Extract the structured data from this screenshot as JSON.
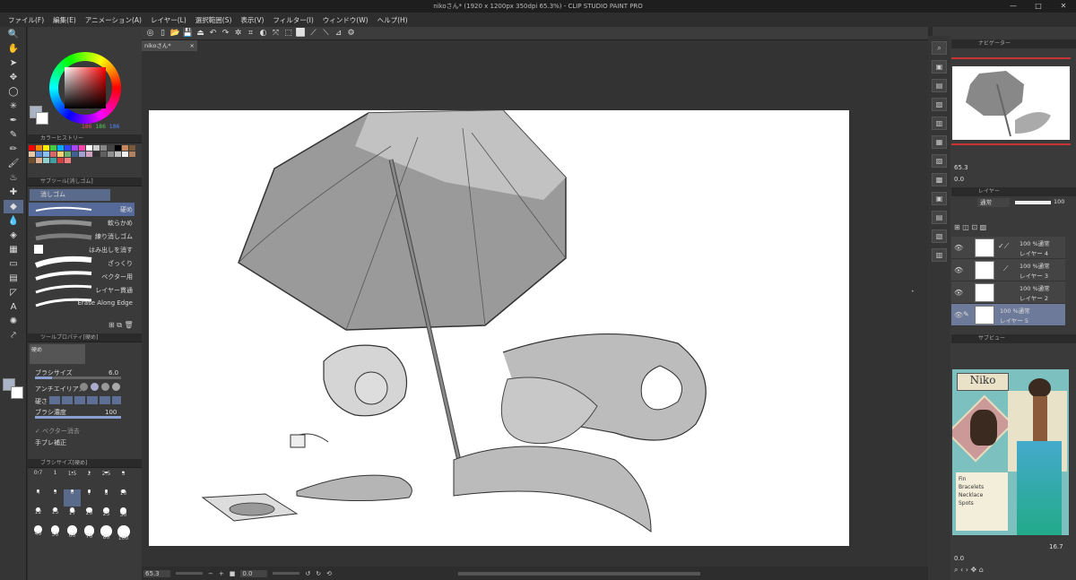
{
  "window": {
    "title": "nikoさん* (1920 x 1200px 350dpi 65.3%) - CLIP STUDIO PAINT PRO",
    "controls": [
      "—",
      "□",
      "✕"
    ]
  },
  "menu": [
    "ファイル(F)",
    "編集(E)",
    "アニメーション(A)",
    "レイヤー(L)",
    "選択範囲(S)",
    "表示(V)",
    "フィルター(I)",
    "ウィンドウ(W)",
    "ヘルプ(H)"
  ],
  "tab": {
    "label": "nikoさん*",
    "close": "×"
  },
  "color": {
    "h": "186",
    "s": "186",
    "v": "186",
    "main": "#a9b4c6",
    "sub": "#ffffff"
  },
  "history_title": "カラーヒストリー",
  "history_colors": [
    "#ff0000",
    "#ff8800",
    "#ffee00",
    "#44cc44",
    "#00aaff",
    "#3344ff",
    "#aa44ff",
    "#ff44aa",
    "#ffffff",
    "#cccccc",
    "#888888",
    "#444444",
    "#000000",
    "#c9885c",
    "#7a5a3a",
    "#e8c8a8",
    "#5a8ad8",
    "#88c0f0",
    "#d86868",
    "#f0d070",
    "#70b070",
    "#406090",
    "#a0a0d0",
    "#d0a0c0",
    "#303030",
    "#606060",
    "#909090",
    "#c0c0c0",
    "#f0f0f0",
    "#b08060",
    "#705030",
    "#e0b090",
    "#90d0d0",
    "#40a0a0",
    "#d04040",
    "#f08080"
  ],
  "subtool": {
    "title": "サブツール[消しゴム]",
    "group": "消しゴム",
    "items": [
      "硬め",
      "軟らかめ",
      "練り消しゴム",
      "はみ出しを消す",
      "ざっくり",
      "ベクター用",
      "レイヤー貫通",
      "Erase Along Edge"
    ]
  },
  "toolprop": {
    "title": "ツールプロパティ[硬め]",
    "name": "硬め",
    "brush_size_label": "ブラシサイズ",
    "brush_size": "6.0",
    "aa_label": "アンチエイリアス",
    "hardness_label": "硬さ",
    "density_label": "ブラシ濃度",
    "density": "100",
    "vector_label": "ベクター消去",
    "correction_label": "手ブレ補正"
  },
  "brushsize": {
    "title": "ブラシサイズ[硬め]",
    "sizes": [
      "0.7",
      "1",
      "1.5",
      "2",
      "2.5",
      "3",
      "4",
      "5",
      "6",
      "7",
      "8",
      "10",
      "12",
      "15",
      "17",
      "20",
      "25",
      "30",
      "40",
      "50",
      "60",
      "70",
      "80",
      "100"
    ],
    "selected": "6"
  },
  "navigator": {
    "tabs": [
      "ナビゲーター",
      "",
      ""
    ],
    "zoom": "65.3",
    "angle": "0.0"
  },
  "layer_panel": {
    "title": "レイヤー",
    "blend": "通常",
    "opacity": "100",
    "layers": [
      {
        "mode": "100 %通常",
        "name": "レイヤー 4",
        "selected": false
      },
      {
        "mode": "100 %通常",
        "name": "レイヤー 3",
        "selected": false
      },
      {
        "mode": "100 %通常",
        "name": "レイヤー 2",
        "selected": false
      },
      {
        "mode": "100 %通常",
        "name": "レイヤー 5",
        "selected": true
      }
    ]
  },
  "subview": {
    "title": "サブビュー",
    "zoom": "16.7",
    "angle": "0.0",
    "ref_title": "Niko",
    "ref_labels": [
      "Fin",
      "Bracelets",
      "Necklace",
      "Spots"
    ]
  },
  "status": {
    "zoom": "65.3",
    "angle": "0.0"
  }
}
